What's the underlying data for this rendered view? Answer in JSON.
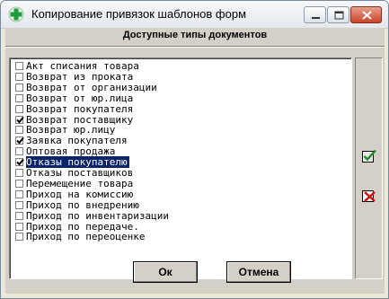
{
  "window": {
    "title": "Копирование привязок шаблонов форм",
    "icon": "green-cross-icon"
  },
  "header": {
    "title": "Доступные типы документов"
  },
  "list": {
    "items": [
      {
        "label": "Акт списания товара",
        "checked": false
      },
      {
        "label": "Возврат из проката",
        "checked": false
      },
      {
        "label": "Возврат от организации",
        "checked": false
      },
      {
        "label": "Возврат от юр.лица",
        "checked": false
      },
      {
        "label": "Возврат покупателя",
        "checked": false
      },
      {
        "label": "Возврат поставщику",
        "checked": true
      },
      {
        "label": "Возврат юр.лицу",
        "checked": false
      },
      {
        "label": "Заявка покупателя",
        "checked": true
      },
      {
        "label": "Оптовая продажа",
        "checked": false
      },
      {
        "label": "Отказы покупателю",
        "checked": true,
        "selected": true
      },
      {
        "label": "Отказы поставщиков",
        "checked": false
      },
      {
        "label": "Перемещение товара",
        "checked": false
      },
      {
        "label": "Приход на комиссию",
        "checked": false
      },
      {
        "label": "Приход по внедрению",
        "checked": false
      },
      {
        "label": "Приход по инвентаризации",
        "checked": false
      },
      {
        "label": "Приход по передаче.",
        "checked": false
      },
      {
        "label": "Приход по переоценке",
        "checked": false
      }
    ]
  },
  "side_buttons": {
    "check_all_icon": "check-all-icon",
    "uncheck_all_icon": "uncheck-all-icon"
  },
  "buttons": {
    "ok_label": "Ок",
    "cancel_label": "Отмена"
  },
  "colors": {
    "selection": "#0a246a",
    "dialog_bg": "#d4d0c8",
    "close_button": "#c8432b"
  }
}
